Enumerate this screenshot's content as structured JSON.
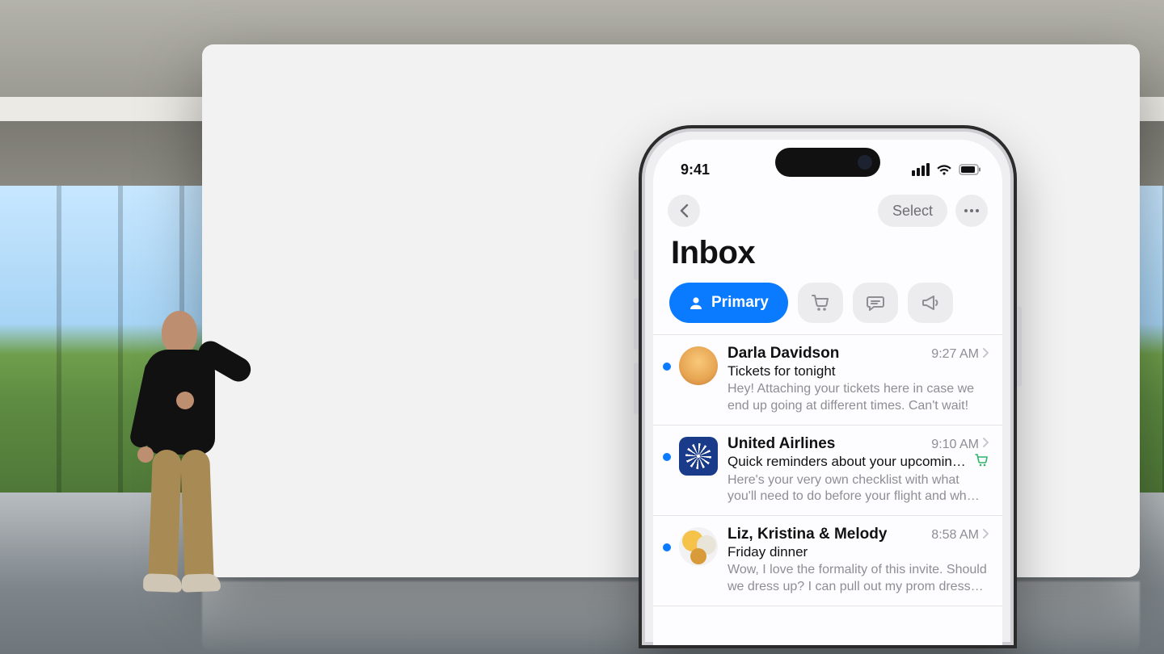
{
  "status": {
    "time": "9:41"
  },
  "nav": {
    "select_label": "Select"
  },
  "page_title": "Inbox",
  "filters": {
    "primary_label": "Primary"
  },
  "messages": [
    {
      "sender": "Darla Davidson",
      "time": "9:27 AM",
      "subject": "Tickets for tonight",
      "preview": "Hey! Attaching your tickets here in case we end up going at different times. Can't wait!",
      "avatar": "memoji",
      "tag": null
    },
    {
      "sender": "United Airlines",
      "time": "9:10 AM",
      "subject": "Quick reminders about your upcoming…",
      "preview": "Here's your very own checklist with what you'll need to do before your flight and wh…",
      "avatar": "ua",
      "tag": "cart"
    },
    {
      "sender": "Liz, Kristina & Melody",
      "time": "8:58 AM",
      "subject": "Friday dinner",
      "preview": "Wow, I love the formality of this invite. Should we dress up? I can pull out my prom dress…",
      "avatar": "group",
      "tag": null
    }
  ]
}
